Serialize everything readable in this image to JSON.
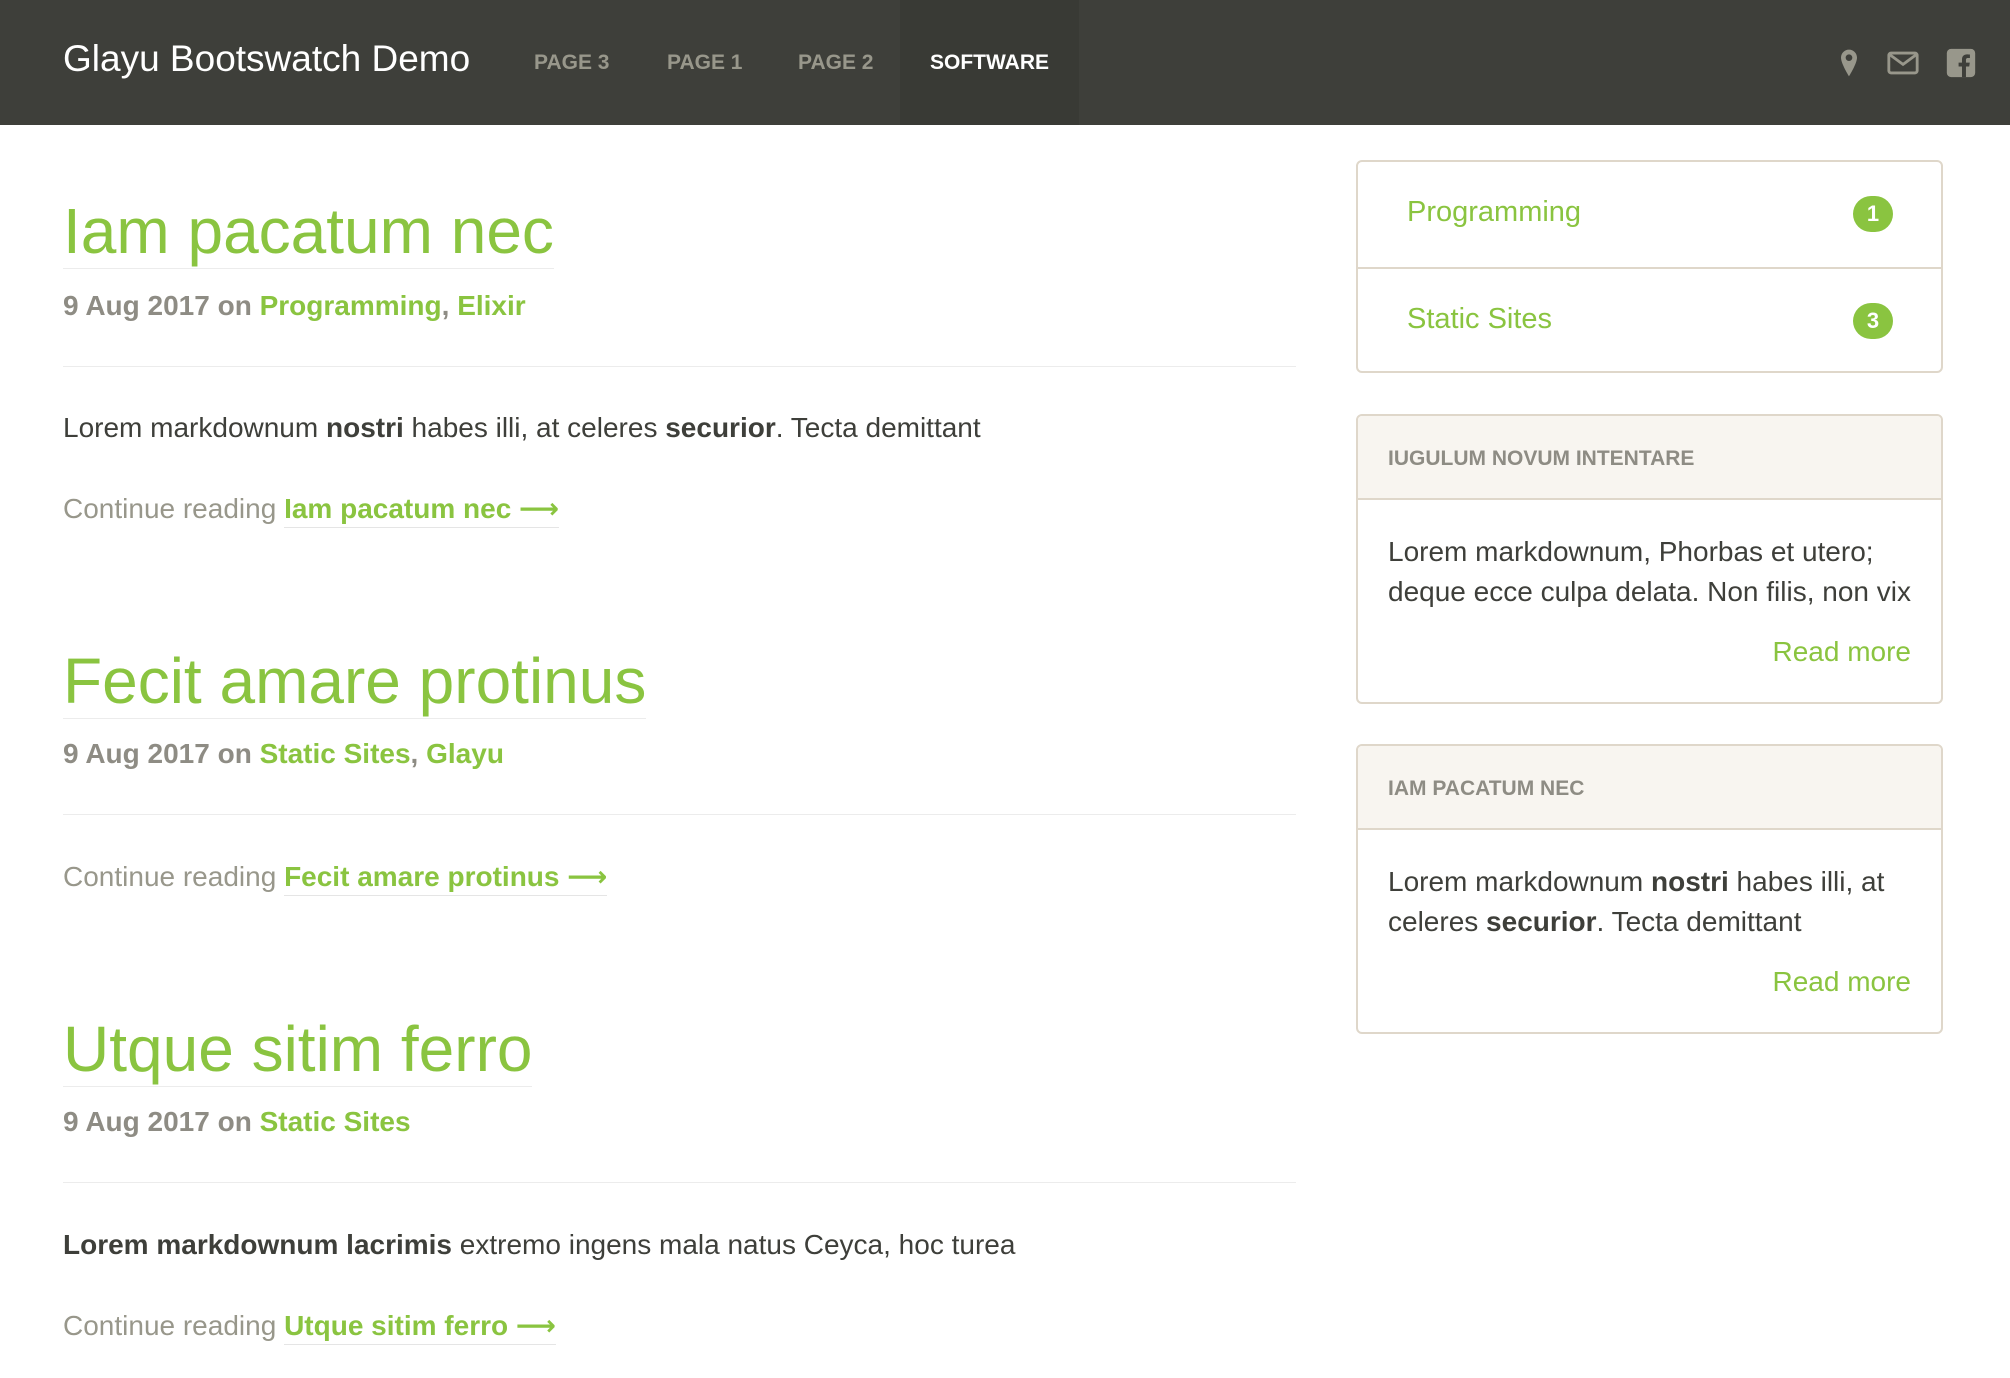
{
  "navbar": {
    "brand": "Glayu Bootswatch Demo",
    "items": [
      {
        "label": "PAGE 3",
        "active": false
      },
      {
        "label": "PAGE 1",
        "active": false
      },
      {
        "label": "PAGE 2",
        "active": false
      },
      {
        "label": "SOFTWARE",
        "active": true
      }
    ],
    "icons": [
      "map-marker-icon",
      "envelope-icon",
      "facebook-icon"
    ]
  },
  "posts": [
    {
      "title": "Iam pacatum nec",
      "date": "9 Aug 2017",
      "on": "on",
      "tags": [
        "Programming",
        "Elixir"
      ],
      "excerpt": {
        "t1": "Lorem markdownum ",
        "b1": "nostri",
        "t2": " habes illi, at celeres ",
        "b2": "securior",
        "t3": ". Tecta demittant"
      },
      "continue_prefix": "Continue reading",
      "continue_link": "Iam pacatum nec"
    },
    {
      "title": "Fecit amare protinus",
      "date": "9 Aug 2017",
      "on": "on",
      "tags": [
        "Static Sites",
        "Glayu"
      ],
      "continue_prefix": "Continue reading",
      "continue_link": "Fecit amare protinus"
    },
    {
      "title": "Utque sitim ferro",
      "date": "9 Aug 2017",
      "on": "on",
      "tags": [
        "Static Sites"
      ],
      "excerpt": {
        "b1": "Lorem markdownum lacrimis",
        "t1": " extremo ingens mala natus Ceyca, hoc turea"
      },
      "continue_prefix": "Continue reading",
      "continue_link": "Utque sitim ferro"
    }
  ],
  "sidebar": {
    "categories": [
      {
        "label": "Programming",
        "count": "1"
      },
      {
        "label": "Static Sites",
        "count": "3"
      }
    ],
    "cards": [
      {
        "header": "IUGULUM NOVUM INTENTARE",
        "line1": "Lorem markdownum, Phorbas et utero;",
        "line2": "deque ecce culpa delata. Non filis, non vix",
        "read_more": "Read more"
      },
      {
        "header": "IAM PACATUM NEC",
        "l1a": "Lorem markdownum ",
        "l1b": "nostri",
        "l1c": " habes illi, at",
        "l2a": "celeres ",
        "l2b": "securior",
        "l2c": ". Tecta demittant",
        "read_more": "Read more"
      }
    ]
  },
  "colors": {
    "navbar": "#3e3f3a",
    "accent": "#8ac440",
    "muted": "#8e8c84",
    "text": "#3e3f3a"
  },
  "arrow": "⟶"
}
